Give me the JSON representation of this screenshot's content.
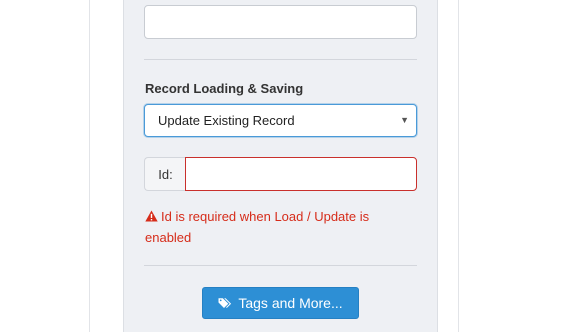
{
  "form": {
    "top_input": {
      "value": "",
      "placeholder": ""
    },
    "record_section": {
      "label": "Record Loading & Saving",
      "select": {
        "selected": "Update Existing Record",
        "caret_icon": "caret-down-icon"
      }
    },
    "id_field": {
      "addon_label": "Id:",
      "value": "",
      "placeholder": "",
      "state": "error"
    },
    "error": {
      "icon": "warning-triangle-icon",
      "message": "Id is required when Load / Update is enabled"
    },
    "tags_button": {
      "icon": "tags-icon",
      "label": "Tags and More..."
    }
  },
  "colors": {
    "panel_bg": "#eef0f4",
    "select_focus_border": "#4a9ad8",
    "error_red": "#d62c1a",
    "button_blue": "#2d8fd5"
  }
}
